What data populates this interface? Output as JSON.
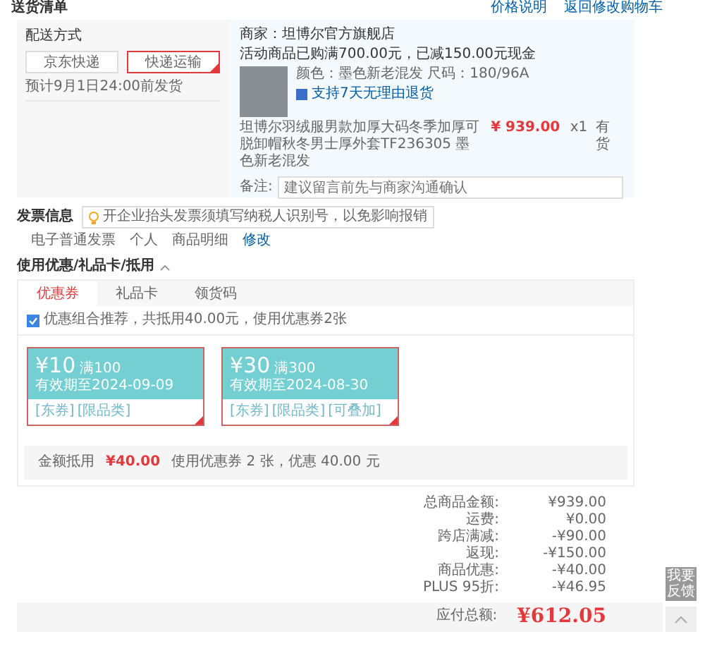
{
  "header": {
    "title": "送货清单",
    "links": [
      "价格说明",
      "返回修改购物车"
    ]
  },
  "delivery": {
    "label": "配送方式",
    "options": [
      {
        "label": "京东快递",
        "selected": false
      },
      {
        "label": "快递运输",
        "selected": true
      }
    ],
    "eta": "预计9月1日24:00前发货"
  },
  "shop": {
    "seller": "商家：坦博尔官方旗舰店",
    "promo": "活动商品已购满700.00元，已减150.00元现金",
    "product": {
      "spec": "颜色：墨色新老混发  尺码：180/96A",
      "return_policy": "支持7天无理由退货",
      "title": "坦博尔羽绒服男款加厚大码冬季加厚可脱卸帽秋冬男士厚外套TF236305 墨色新老混发",
      "price": "¥ 939.00",
      "quantity": "x1",
      "stock": "有货"
    },
    "remark": {
      "label": "备注:",
      "placeholder": "建议留言前先与商家沟通确认"
    }
  },
  "invoice": {
    "title": "发票信息",
    "tip": "开企业抬头发票须填写纳税人识别号，以免影响报销",
    "type": "电子普通发票",
    "holder": "个人",
    "content": "商品明细",
    "edit": "修改"
  },
  "discounts": {
    "title": "使用优惠/礼品卡/抵用",
    "expanded": true,
    "tabs": [
      {
        "label": "优惠券",
        "selected": true
      },
      {
        "label": "礼品卡",
        "selected": false
      },
      {
        "label": "领货码",
        "selected": false
      }
    ],
    "recommend": {
      "checked": true,
      "label": "优惠组合推荐，共抵用40.00元，使用优惠券2张"
    },
    "coupons": [
      {
        "amount": "¥10",
        "condition": "满100",
        "expiry": "有效期至2024-09-09",
        "tags": [
          "[东券]",
          "[限品类]"
        ],
        "selected": true
      },
      {
        "amount": "¥30",
        "condition": "满300",
        "expiry": "有效期至2024-08-30",
        "tags": [
          "[东券]",
          "[限品类]",
          "[可叠加]"
        ],
        "selected": true
      }
    ],
    "summary": {
      "label": "金额抵用",
      "amount": "¥40.00",
      "detail": "使用优惠券 2 张，优惠 40.00 元"
    }
  },
  "totals": [
    {
      "label": "总商品金额:",
      "value": "¥939.00"
    },
    {
      "label": "运费:",
      "value": "¥0.00"
    },
    {
      "label": "跨店满减:",
      "value": "-¥90.00"
    },
    {
      "label": "返现:",
      "value": "-¥150.00"
    },
    {
      "label": "商品优惠:",
      "value": "-¥40.00"
    },
    {
      "label": "PLUS 95折:",
      "value": "-¥46.95"
    }
  ],
  "payable": {
    "label": "应付总额:",
    "value": "¥612.05"
  },
  "side": {
    "feedback": "我要反馈"
  }
}
